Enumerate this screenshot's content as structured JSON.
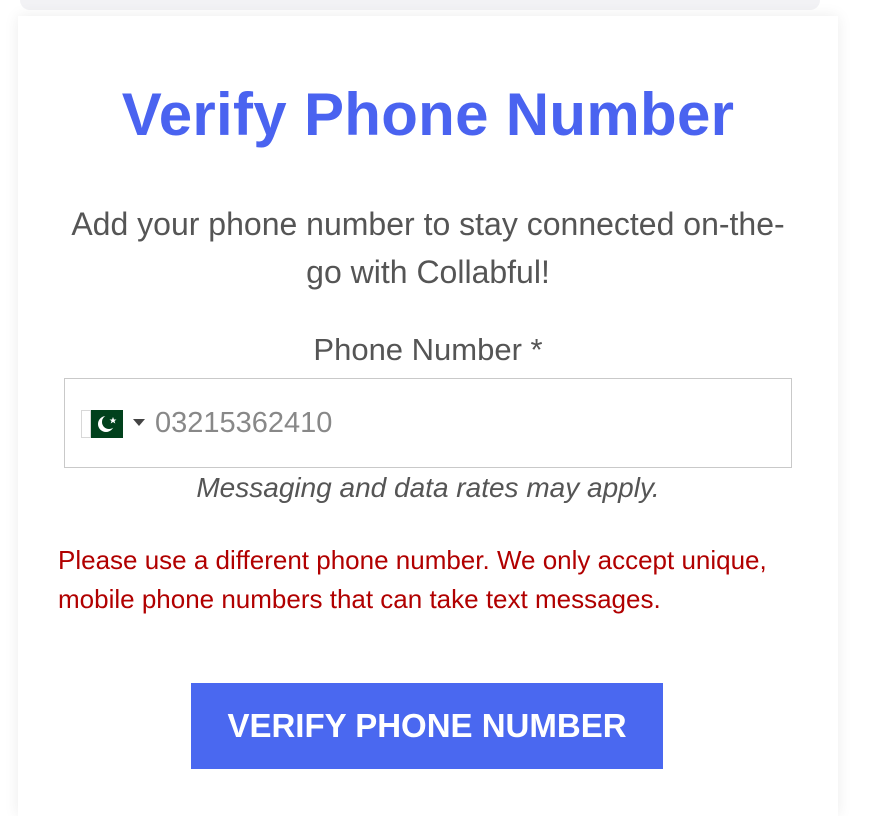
{
  "page": {
    "title": "Verify Phone Number",
    "subtitle": "Add your phone number to stay connected on-the-go with Collabful!"
  },
  "phone_field": {
    "label": "Phone Number *",
    "country_flag_icon": "pakistan-flag-icon",
    "placeholder": "03215362410",
    "value": "",
    "note": "Messaging and data rates may apply."
  },
  "error": {
    "message": "Please use a different phone number. We only accept unique, mobile phone numbers that can take text messages."
  },
  "actions": {
    "verify_label": "VERIFY PHONE NUMBER"
  },
  "colors": {
    "accent": "#4a63f0",
    "button": "#4a68f0",
    "error": "#b10000",
    "text": "#555555"
  }
}
